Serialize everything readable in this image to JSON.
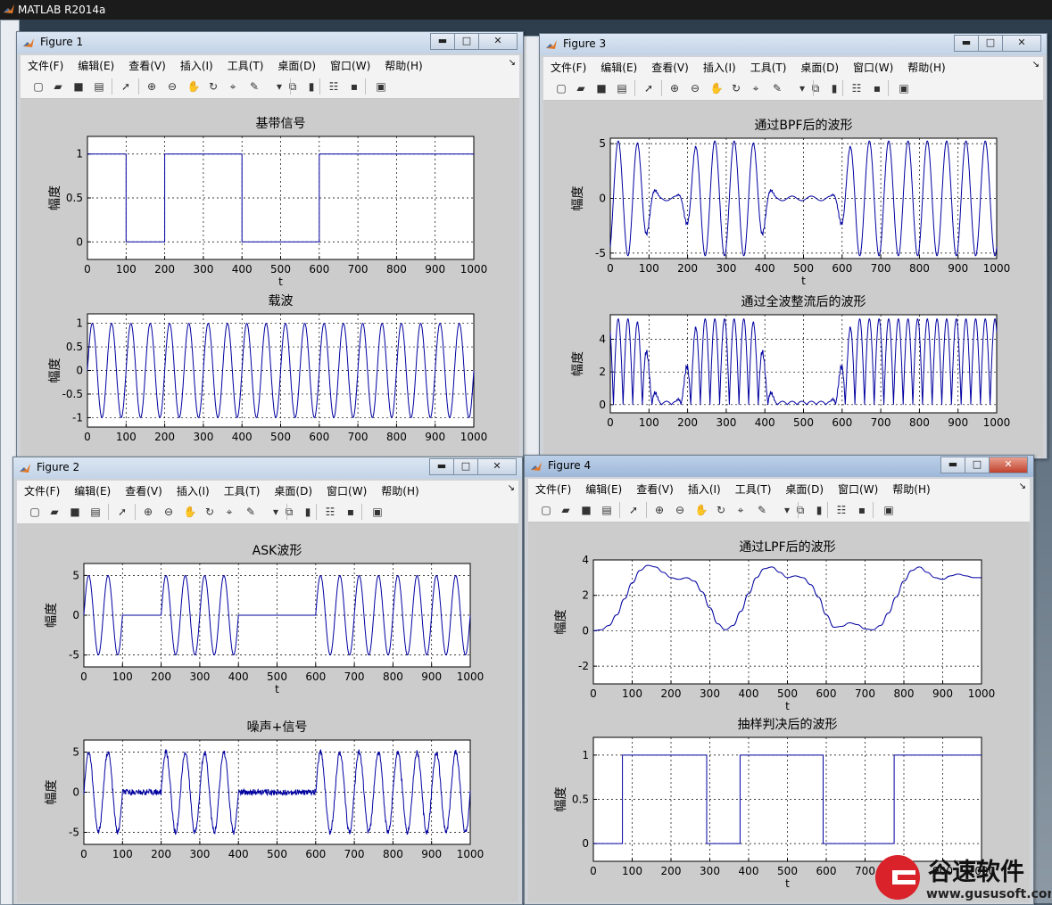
{
  "app": {
    "title": "MATLAB R2014a"
  },
  "menu": [
    "文件(F)",
    "编辑(E)",
    "查看(V)",
    "插入(I)",
    "工具(T)",
    "桌面(D)",
    "窗口(W)",
    "帮助(H)"
  ],
  "menu_grip": "↘",
  "toolbar_icons": [
    "new-figure-icon",
    "open-file-icon",
    "save-icon",
    "print-icon",
    "pointer-icon",
    "zoom-in-icon",
    "zoom-out-icon",
    "pan-icon",
    "rotate-icon",
    "data-cursor-icon",
    "brush-icon",
    "brush-dropdown-icon",
    "link-plot-icon",
    "colorbar-icon",
    "legend-icon",
    "hide-plot-tools-icon",
    "show-plot-tools-icon"
  ],
  "windows": [
    {
      "title": "Figure 1",
      "buttons": [
        "▬",
        "□",
        "✕"
      ]
    },
    {
      "title": "Figure 2",
      "buttons": [
        "▬",
        "□",
        "✕"
      ]
    },
    {
      "title": "Figure 3",
      "buttons": [
        "▬",
        "□",
        "✕"
      ]
    },
    {
      "title": "Figure 4",
      "buttons": [
        "▬",
        "□",
        "✕"
      ]
    }
  ],
  "watermark": {
    "brand": "谷速软件",
    "url": "www.gususoft.com",
    "color": "#d9222a"
  },
  "chart_data": [
    {
      "figure": "Figure 1",
      "type": "line",
      "title": "基带信号",
      "xlabel": "t",
      "ylabel": "幅度",
      "xlim": [
        0,
        1000
      ],
      "ylim": [
        -0.2,
        1.2
      ],
      "xticks": [
        0,
        100,
        200,
        300,
        400,
        500,
        600,
        700,
        800,
        900,
        1000
      ],
      "yticks": [
        0,
        0.5,
        1
      ],
      "ytick_labels": [
        "0",
        "0.5",
        "1"
      ],
      "grid": true,
      "color": "#0000a0",
      "series": [
        {
          "kind": "step",
          "values": [
            1,
            0,
            1,
            1,
            0,
            0,
            1,
            1,
            1,
            1
          ]
        }
      ]
    },
    {
      "figure": "Figure 1",
      "type": "line",
      "title": "载波",
      "xlabel": "",
      "ylabel": "幅度",
      "xlim": [
        0,
        1000
      ],
      "ylim": [
        -1.2,
        1.2
      ],
      "xticks": [
        0,
        100,
        200,
        300,
        400,
        500,
        600,
        700,
        800,
        900,
        1000
      ],
      "yticks": [
        -1,
        -0.5,
        0,
        0.5,
        1
      ],
      "ytick_labels": [
        "-1",
        "-0.5",
        "0",
        "0.5",
        "1"
      ],
      "grid": true,
      "color": "#0000a0",
      "series": [
        {
          "kind": "sine",
          "amplitude": 1,
          "period": 50
        }
      ]
    },
    {
      "figure": "Figure 2",
      "type": "line",
      "title": "ASK波形",
      "xlabel": "t",
      "ylabel": "幅度",
      "xlim": [
        0,
        1000
      ],
      "ylim": [
        -6.5,
        6.5
      ],
      "xticks": [
        0,
        100,
        200,
        300,
        400,
        500,
        600,
        700,
        800,
        900,
        1000
      ],
      "yticks": [
        -5,
        0,
        5
      ],
      "ytick_labels": [
        "-5",
        "0",
        "5"
      ],
      "grid": true,
      "color": "#0000a0",
      "series": [
        {
          "kind": "ask",
          "amplitude": 5,
          "period": 50,
          "bits": [
            1,
            0,
            1,
            1,
            0,
            0,
            1,
            1,
            1,
            1
          ]
        }
      ]
    },
    {
      "figure": "Figure 2",
      "type": "line",
      "title": "噪声+信号",
      "xlabel": "",
      "ylabel": "幅度",
      "xlim": [
        0,
        1000
      ],
      "ylim": [
        -6.5,
        6.5
      ],
      "xticks": [
        0,
        100,
        200,
        300,
        400,
        500,
        600,
        700,
        800,
        900,
        1000
      ],
      "yticks": [
        -5,
        0,
        5
      ],
      "ytick_labels": [
        "-5",
        "0",
        "5"
      ],
      "grid": true,
      "color": "#0000a0",
      "series": [
        {
          "kind": "ask-noise",
          "amplitude": 5,
          "period": 50,
          "noise": 0.35,
          "bits": [
            1,
            0,
            1,
            1,
            0,
            0,
            1,
            1,
            1,
            1
          ]
        }
      ]
    },
    {
      "figure": "Figure 3",
      "type": "line",
      "title": "通过BPF后的波形",
      "xlabel": "t",
      "ylabel": "幅度",
      "xlim": [
        0,
        1000
      ],
      "ylim": [
        -5.5,
        5.5
      ],
      "xticks": [
        0,
        100,
        200,
        300,
        400,
        500,
        600,
        700,
        800,
        900,
        1000
      ],
      "yticks": [
        -5,
        0,
        5
      ],
      "ytick_labels": [
        "-5",
        "0",
        "5"
      ],
      "grid": true,
      "color": "#0000a0",
      "series": [
        {
          "kind": "bpf",
          "amplitude": 5,
          "period": 50,
          "bits": [
            1,
            0,
            1,
            1,
            0,
            0,
            1,
            1,
            1,
            1
          ]
        }
      ]
    },
    {
      "figure": "Figure 3",
      "type": "line",
      "title": "通过全波整流后的波形",
      "xlabel": "",
      "ylabel": "幅度",
      "xlim": [
        0,
        1000
      ],
      "ylim": [
        -0.5,
        5.5
      ],
      "xticks": [
        0,
        100,
        200,
        300,
        400,
        500,
        600,
        700,
        800,
        900,
        1000
      ],
      "yticks": [
        0,
        2,
        4
      ],
      "ytick_labels": [
        "0",
        "2",
        "4"
      ],
      "grid": true,
      "color": "#0000a0",
      "series": [
        {
          "kind": "rectified",
          "amplitude": 5,
          "period": 50,
          "bits": [
            1,
            0,
            1,
            1,
            0,
            0,
            1,
            1,
            1,
            1
          ]
        }
      ]
    },
    {
      "figure": "Figure 4",
      "type": "line",
      "title": "通过LPF后的波形",
      "xlabel": "t",
      "ylabel": "幅度",
      "xlim": [
        0,
        1000
      ],
      "ylim": [
        -3,
        4
      ],
      "xticks": [
        0,
        100,
        200,
        300,
        400,
        500,
        600,
        700,
        800,
        900,
        1000
      ],
      "yticks": [
        -2,
        0,
        2,
        4
      ],
      "ytick_labels": [
        "-2",
        "0",
        "2",
        "4"
      ],
      "grid": true,
      "color": "#0000a0",
      "series": [
        {
          "kind": "points",
          "x": [
            0,
            20,
            40,
            60,
            80,
            100,
            120,
            140,
            160,
            180,
            200,
            220,
            240,
            260,
            280,
            300,
            320,
            340,
            360,
            380,
            400,
            420,
            440,
            460,
            480,
            500,
            520,
            540,
            560,
            580,
            600,
            620,
            640,
            660,
            680,
            700,
            720,
            740,
            760,
            780,
            800,
            820,
            840,
            860,
            880,
            900,
            920,
            940,
            960,
            980,
            1000
          ],
          "y": [
            0,
            0.05,
            0.3,
            0.9,
            1.8,
            2.7,
            3.4,
            3.7,
            3.6,
            3.3,
            3.0,
            2.9,
            3.0,
            2.8,
            2.2,
            1.3,
            0.4,
            0.05,
            0.3,
            1.1,
            2.1,
            3.0,
            3.5,
            3.6,
            3.3,
            3.0,
            3.1,
            3.0,
            2.6,
            1.9,
            0.9,
            0.2,
            0.25,
            0.45,
            0.35,
            0.1,
            0.05,
            0.3,
            1.0,
            1.9,
            2.8,
            3.4,
            3.6,
            3.3,
            3.0,
            2.9,
            3.1,
            3.2,
            3.1,
            3.0,
            3.0
          ]
        }
      ]
    },
    {
      "figure": "Figure 4",
      "type": "line",
      "title": "抽样判决后的波形",
      "xlabel": "t",
      "ylabel": "幅度",
      "xlim": [
        0,
        1000
      ],
      "ylim": [
        -0.2,
        1.2
      ],
      "xticks": [
        0,
        100,
        200,
        300,
        400,
        500,
        600,
        700,
        800,
        900,
        1000
      ],
      "yticks": [
        0,
        0.5,
        1
      ],
      "ytick_labels": [
        "0",
        "0.5",
        "1"
      ],
      "grid": true,
      "color": "#0000a0",
      "series": [
        {
          "kind": "edges",
          "x": [
            0,
            75,
            75,
            292,
            292,
            378,
            378,
            592,
            592,
            775,
            775,
            1000
          ],
          "y": [
            0,
            0,
            1,
            1,
            0,
            0,
            1,
            1,
            0,
            0,
            1,
            1
          ]
        }
      ]
    }
  ]
}
